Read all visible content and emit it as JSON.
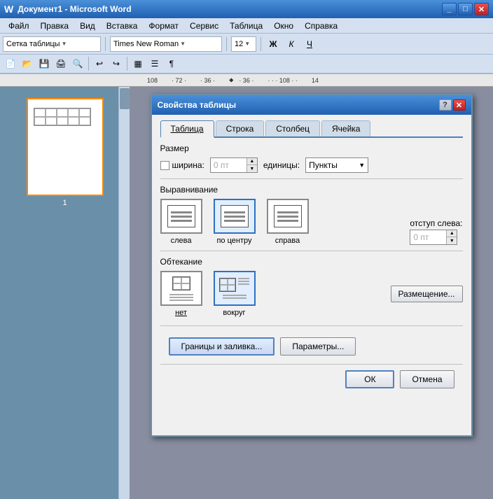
{
  "titleBar": {
    "title": "Документ1 - Microsoft Word",
    "icon": "W",
    "controls": [
      "_",
      "□",
      "✕"
    ]
  },
  "menuBar": {
    "items": [
      "Файл",
      "Правка",
      "Вид",
      "Вставка",
      "Формат",
      "Сервис",
      "Таблица",
      "Окно",
      "Справка"
    ]
  },
  "toolbar1": {
    "styleDropdown": "Сетка таблицы",
    "fontDropdown": "Times New Roman",
    "sizeDropdown": "12",
    "boldLabel": "Ж",
    "italicLabel": "К",
    "underlineLabel": "Ч"
  },
  "pageNum": "1",
  "dialog": {
    "title": "Свойства таблицы",
    "tabs": [
      "Таблица",
      "Строка",
      "Столбец",
      "Ячейка"
    ],
    "activeTab": "Таблица",
    "sizeSection": {
      "label": "Размер",
      "widthCheckbox": false,
      "widthLabel": "ширина:",
      "widthValue": "0 пт",
      "unitsLabel": "единицы:",
      "unitsValue": "Пункты"
    },
    "alignSection": {
      "label": "Выравнивание",
      "options": [
        "слева",
        "по центру",
        "справа"
      ],
      "selectedIndex": 1,
      "indentLabel": "отступ слева:",
      "indentValue": "0 пт"
    },
    "wrapSection": {
      "label": "Обтекание",
      "options": [
        "нет",
        "вокруг"
      ],
      "selectedIndex": 1
    },
    "buttons": {
      "borders": "Границы и заливка...",
      "options": "Параметры...",
      "ok": "ОК",
      "cancel": "Отмена",
      "placement": "Размещение..."
    }
  }
}
